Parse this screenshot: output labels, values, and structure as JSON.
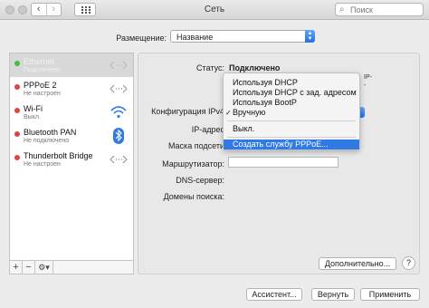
{
  "window": {
    "title": "Сеть"
  },
  "toolbar": {
    "back_icon": "chevron-left-icon",
    "forward_icon": "chevron-right-icon",
    "grid_icon": "grid-icon",
    "search_placeholder": "Поиск",
    "search_value": ""
  },
  "location": {
    "label": "Размещение:",
    "value": "Название"
  },
  "services": [
    {
      "name": "Ethernet",
      "status": "Подключено",
      "status_color": "#3fbf3f",
      "icon": "ethernet-arrows-icon",
      "selected": true
    },
    {
      "name": "PPPoE 2",
      "status": "Не настроен",
      "status_color": "#e0443e",
      "icon": "ethernet-arrows-icon"
    },
    {
      "name": "Wi-Fi",
      "status": "Выкл.",
      "status_color": "#e0443e",
      "icon": "wifi-icon"
    },
    {
      "name": "Bluetooth PAN",
      "status": "Не подключено",
      "status_color": "#e0443e",
      "icon": "bluetooth-icon"
    },
    {
      "name": "Thunderbolt Bridge",
      "status": "Не настроен",
      "status_color": "#e0443e",
      "icon": "ethernet-arrows-icon"
    }
  ],
  "sidebar_footer": {
    "add": "+",
    "remove": "−",
    "gear": "⚙▾"
  },
  "details": {
    "status_label": "Статус:",
    "status_value": "Подключено",
    "ip_note_1": "IP-",
    "ip_note_2": "-",
    "config_label": "Конфигурация IPv4",
    "ip_label": "IP-адрес",
    "mask_label": "Маска подсети",
    "router_label": "Маршрутизатор:",
    "dns_label": "DNS-сервер:",
    "domains_label": "Домены поиска:",
    "advanced": "Дополнительно...",
    "help": "?"
  },
  "menu": {
    "items": [
      "Используя DHCP",
      "Используя DHCP с зад. адресом",
      "Используя BootP",
      "Вручную",
      "Выкл.",
      "Создать службу PPPoE..."
    ],
    "checked_index": 3,
    "highlighted_index": 5,
    "check_mark": "✓"
  },
  "buttons": {
    "assist": "Ассистент...",
    "revert": "Вернуть",
    "apply": "Применить"
  }
}
